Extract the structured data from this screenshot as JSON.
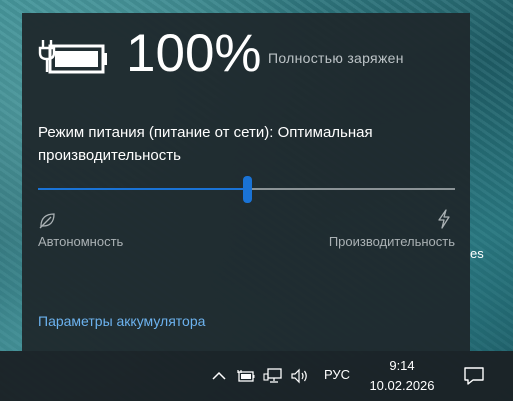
{
  "desktop": {
    "peek_text": "es"
  },
  "battery_flyout": {
    "percent": "100%",
    "status": "Полностью заряжен",
    "power_mode_text": "Режим питания (питание от сети): Оптимальная производительность",
    "slider": {
      "value_fraction": 0.5,
      "left_label": "Автономность",
      "right_label": "Производительность",
      "left_icon": "leaf-icon",
      "right_icon": "lightning-bolt-icon",
      "accent_color": "#1a73d6"
    },
    "settings_link": "Параметры аккумулятора",
    "battery_icon": "battery-charging-full-icon"
  },
  "taskbar": {
    "tray_icons": [
      "chevron-up-icon",
      "battery-icon",
      "network-icon",
      "volume-icon"
    ],
    "language": "РУС",
    "time": "9:14",
    "date": "10.02.2026",
    "notification_icon": "action-center-icon"
  }
}
